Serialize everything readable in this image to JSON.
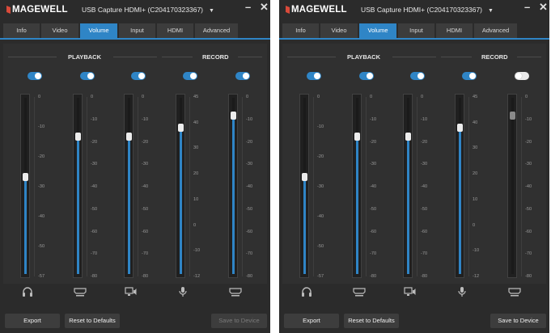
{
  "panels": [
    {
      "brand": "MAGEWELL",
      "device": "USB Capture HDMI+ (C204170323367)",
      "tabs": [
        "Info",
        "Video",
        "Volume",
        "Input",
        "HDMI",
        "Advanced"
      ],
      "active_tab": "Volume",
      "sections": {
        "playback": "PLAYBACK",
        "record": "RECORD"
      },
      "channels": [
        {
          "icon": "headphones-icon",
          "enabled": true,
          "level": 0.55,
          "ticks": [
            "0",
            "-10",
            "-20",
            "-30",
            "-40",
            "-50",
            "-57"
          ]
        },
        {
          "icon": "hdmi-icon",
          "enabled": true,
          "level": 0.78,
          "ticks": [
            "0",
            "-10",
            "-20",
            "-30",
            "-40",
            "-50",
            "-60",
            "-70",
            "-80"
          ]
        },
        {
          "icon": "monitor-speaker-icon",
          "enabled": true,
          "level": 0.78,
          "ticks": [
            "0",
            "-10",
            "-20",
            "-30",
            "-40",
            "-50",
            "-60",
            "-70",
            "-80"
          ]
        },
        {
          "icon": "microphone-icon",
          "enabled": true,
          "level": 0.83,
          "ticks": [
            "45",
            "40",
            "30",
            "20",
            "10",
            "0",
            "-10",
            "-12"
          ]
        },
        {
          "icon": "hdmi-icon",
          "enabled": true,
          "level": 0.9,
          "ticks": [
            "0",
            "-10",
            "-20",
            "-30",
            "-40",
            "-50",
            "-60",
            "-70",
            "-80"
          ]
        }
      ],
      "buttons": {
        "export": "Export",
        "reset": "Reset to Defaults",
        "save": "Save to Device",
        "save_enabled": false
      }
    },
    {
      "brand": "MAGEWELL",
      "device": "USB Capture HDMI+ (C204170323367)",
      "tabs": [
        "Info",
        "Video",
        "Volume",
        "Input",
        "HDMI",
        "Advanced"
      ],
      "active_tab": "Volume",
      "sections": {
        "playback": "PLAYBACK",
        "record": "RECORD"
      },
      "channels": [
        {
          "icon": "headphones-icon",
          "enabled": true,
          "level": 0.55,
          "ticks": [
            "0",
            "-10",
            "-20",
            "-30",
            "-40",
            "-50",
            "-57"
          ]
        },
        {
          "icon": "hdmi-icon",
          "enabled": true,
          "level": 0.78,
          "ticks": [
            "0",
            "-10",
            "-20",
            "-30",
            "-40",
            "-50",
            "-60",
            "-70",
            "-80"
          ]
        },
        {
          "icon": "monitor-speaker-icon",
          "enabled": true,
          "level": 0.78,
          "ticks": [
            "0",
            "-10",
            "-20",
            "-30",
            "-40",
            "-50",
            "-60",
            "-70",
            "-80"
          ]
        },
        {
          "icon": "microphone-icon",
          "enabled": true,
          "level": 0.83,
          "ticks": [
            "45",
            "40",
            "30",
            "20",
            "10",
            "0",
            "-10",
            "-12"
          ]
        },
        {
          "icon": "hdmi-icon",
          "enabled": false,
          "level": 0.9,
          "ticks": [
            "0",
            "-10",
            "-20",
            "-30",
            "-40",
            "-50",
            "-60",
            "-70",
            "-80"
          ]
        }
      ],
      "buttons": {
        "export": "Export",
        "reset": "Reset to Defaults",
        "save": "Save to Device",
        "save_enabled": true
      }
    }
  ],
  "colors": {
    "accent": "#2f85c6",
    "background": "#2b2b2b",
    "brand_mark": "#d94a3a"
  }
}
